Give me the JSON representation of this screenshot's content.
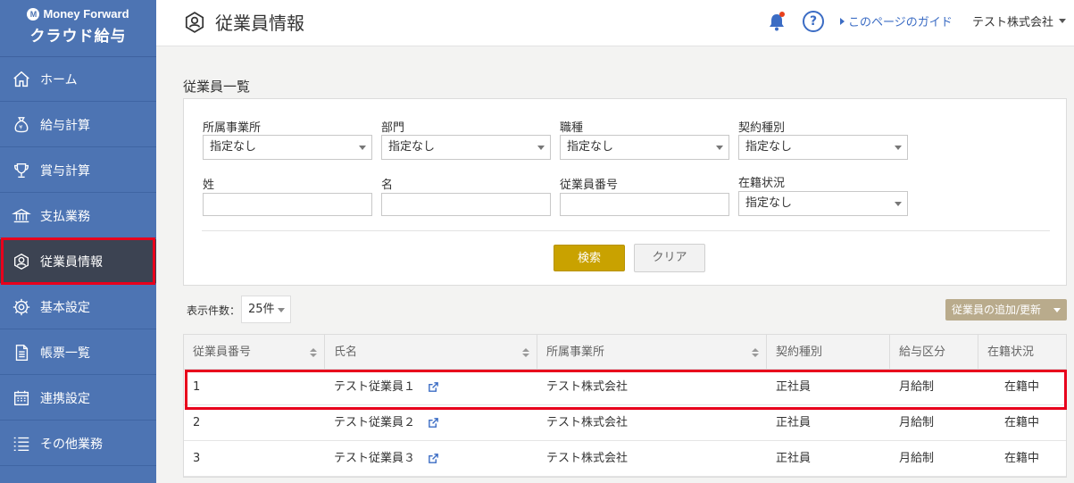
{
  "brand": {
    "company": "Money Forward",
    "product": "クラウド給与"
  },
  "sidebar": {
    "items": [
      {
        "label": "ホーム",
        "icon": "home-icon"
      },
      {
        "label": "給与計算",
        "icon": "money-bag-icon"
      },
      {
        "label": "賞与計算",
        "icon": "trophy-icon"
      },
      {
        "label": "支払業務",
        "icon": "bank-icon"
      },
      {
        "label": "従業員情報",
        "icon": "employee-icon",
        "active": true
      },
      {
        "label": "基本設定",
        "icon": "gear-icon"
      },
      {
        "label": "帳票一覧",
        "icon": "document-icon"
      },
      {
        "label": "連携設定",
        "icon": "calendar-icon"
      },
      {
        "label": "その他業務",
        "icon": "list-icon"
      }
    ]
  },
  "header": {
    "title": "従業員情報",
    "help": "?",
    "guide_link": "このページのガイド",
    "company": "テスト株式会社"
  },
  "section_title": "従業員一覧",
  "filters": {
    "office_label": "所属事業所",
    "office_value": "指定なし",
    "department_label": "部門",
    "department_value": "指定なし",
    "job_label": "職種",
    "job_value": "指定なし",
    "contract_label": "契約種別",
    "contract_value": "指定なし",
    "last_name_label": "姓",
    "last_name_value": "",
    "first_name_label": "名",
    "first_name_value": "",
    "employee_no_label": "従業員番号",
    "employee_no_value": "",
    "status_label": "在籍状況",
    "status_value": "指定なし",
    "search_button": "検索",
    "clear_button": "クリア"
  },
  "table_controls": {
    "per_page_label": "表示件数：",
    "per_page_value": "25件",
    "add_update_button": "従業員の追加/更新"
  },
  "table": {
    "columns": [
      "従業員番号",
      "氏名",
      "所属事業所",
      "契約種別",
      "給与区分",
      "在籍状況"
    ],
    "rows": [
      {
        "no": "1",
        "name": "テスト従業員１",
        "office": "テスト株式会社",
        "contract": "正社員",
        "pay": "月給制",
        "status": "在籍中"
      },
      {
        "no": "2",
        "name": "テスト従業員２",
        "office": "テスト株式会社",
        "contract": "正社員",
        "pay": "月給制",
        "status": "在籍中"
      },
      {
        "no": "3",
        "name": "テスト従業員３",
        "office": "テスト株式会社",
        "contract": "正社員",
        "pay": "月給制",
        "status": "在籍中"
      }
    ]
  },
  "colors": {
    "sidebar": "#4d74b3",
    "sidebar_active": "#3c4352",
    "highlight": "#e8001c",
    "search_button": "#c9a200",
    "add_button": "#b9ab8c",
    "link": "#3b6cc4"
  }
}
